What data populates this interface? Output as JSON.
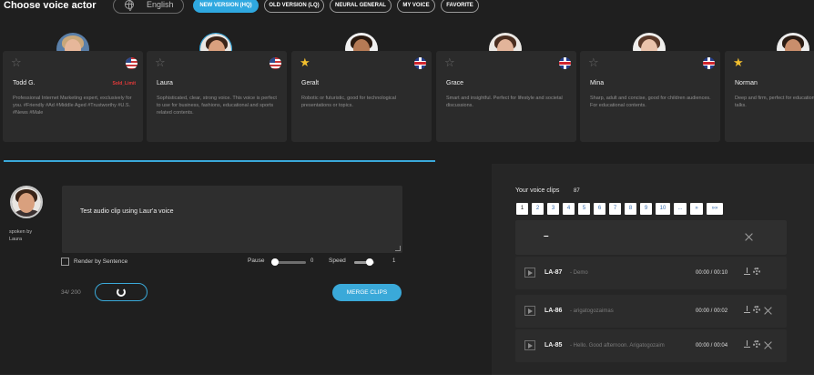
{
  "header": {
    "title": "Choose voice actor",
    "language": "English",
    "tabs": [
      {
        "label": "NEW VERSION (HQ)",
        "active": true
      },
      {
        "label": "OLD VERSION (LQ)",
        "active": false
      },
      {
        "label": "NEURAL GENERAL",
        "active": false
      },
      {
        "label": "MY VOICE",
        "active": false
      },
      {
        "label": "FAVORITE",
        "active": false
      }
    ]
  },
  "voices": [
    {
      "name": "Todd G.",
      "badge": "Sold_Limit",
      "flag": "us",
      "favorite": false,
      "selected": false,
      "desc": "Professional Internet Marketing expert, exclusively for you. #Friendly #Ad #Middle Aged #Trustworthy #U.S. #News #Male"
    },
    {
      "name": "Laura",
      "badge": "",
      "flag": "us",
      "favorite": false,
      "selected": true,
      "desc": "Sophisticated, clear, strong voice. This voice is perfect to use for business, fashions, educational and sports related contents."
    },
    {
      "name": "Geralt",
      "badge": "",
      "flag": "uk",
      "favorite": true,
      "selected": false,
      "desc": "Robotic or futuristic, good for technological presentations or topics."
    },
    {
      "name": "Grace",
      "badge": "",
      "flag": "uk",
      "favorite": false,
      "selected": false,
      "desc": "Smart and insightful. Perfect for lifestyle and societal discussions."
    },
    {
      "name": "Mina",
      "badge": "",
      "flag": "uk",
      "favorite": false,
      "selected": false,
      "desc": "Sharp, adult and concise, good for children audiences. For educational contents."
    },
    {
      "name": "Norman",
      "badge": "",
      "flag": "",
      "favorite": true,
      "selected": false,
      "desc": "Deep and firm, perfect for educational topics and social talks."
    }
  ],
  "editor": {
    "spoken_by": "spoken by Laura",
    "text": "Test audio clip using Laur'a voice",
    "render_by_sentence": "Render by Sentence",
    "pause_label": "Pause",
    "pause_value": "0",
    "speed_label": "Speed",
    "speed_value": "1",
    "char_count": "34/ 200",
    "merge_label": "MERGE CLIPS"
  },
  "clips": {
    "title": "Your voice clips",
    "count": "87",
    "pages": [
      "1",
      "2",
      "3",
      "4",
      "5",
      "6",
      "7",
      "8",
      "9",
      "10",
      "...",
      "»",
      "»»"
    ],
    "current_page": "1",
    "new_clip_text": "–",
    "items": [
      {
        "id": "LA-87",
        "text": "- Demo",
        "time": "00:00 / 00:10"
      },
      {
        "id": "LA-86",
        "text": "- arigatogozaimas",
        "time": "00:00 / 00:02"
      },
      {
        "id": "LA-85",
        "text": "- Hello. Good afternoon. Arigatogozaim",
        "time": "00:00 / 00:04"
      }
    ]
  },
  "colors": {
    "accent": "#2fa8e0",
    "panel": "#2b2b2b",
    "background": "#1f1f1f",
    "sold_badge": "#e53a3a",
    "favorite_star": "#f2bf2e"
  }
}
